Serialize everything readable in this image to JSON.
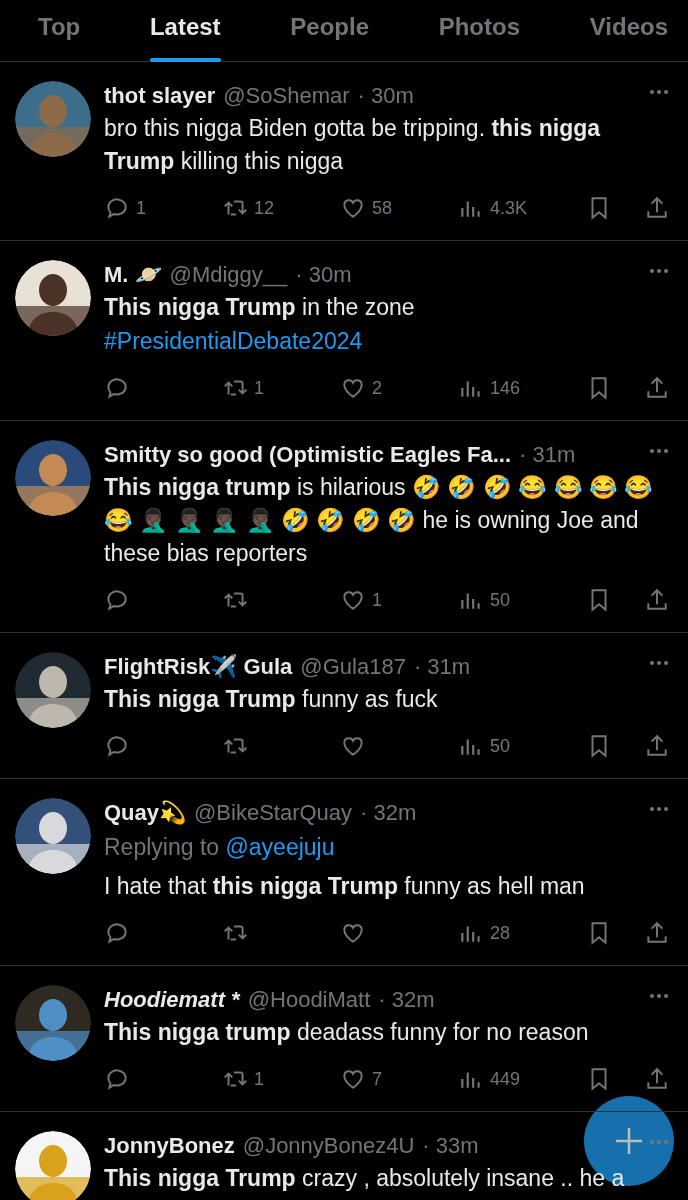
{
  "tabs": [
    {
      "label": "Top",
      "selected": false
    },
    {
      "label": "Latest",
      "selected": true
    },
    {
      "label": "People",
      "selected": false
    },
    {
      "label": "Photos",
      "selected": false
    },
    {
      "label": "Videos",
      "selected": false
    }
  ],
  "tweets": [
    {
      "name": "thot slayer",
      "italic": false,
      "handle": "@SoShemar",
      "time": "· 30m",
      "text": "bro this nigga Biden gotta be tripping. **this nigga Trump** killing this nigga",
      "stats": {
        "replies": "1",
        "retweets": "12",
        "likes": "58",
        "views": "4.3K"
      }
    },
    {
      "name": "M. 🪐",
      "italic": false,
      "handle": "@Mdiggy__",
      "time": "· 30m",
      "text": "**This nigga Trump** in the zone",
      "hashtag": "#PresidentialDebate2024",
      "stats": {
        "retweets": "1",
        "likes": "2",
        "views": "146"
      }
    },
    {
      "name": "Smitty so good (Optimistic Eagles Fa...",
      "italic": false,
      "time": "· 31m",
      "text": "**This nigga trump** is hilarious 🤣 🤣 🤣 😂 😂 😂 😂 😂 🤦🏿‍♂️ 🤦🏿‍♂️ 🤦🏿‍♂️ 🤦🏿‍♂️ 🤣 🤣 🤣 🤣 he is owning Joe and these bias reporters",
      "stats": {
        "likes": "1",
        "views": "50"
      }
    },
    {
      "name": "FlightRisk✈️ Gula",
      "italic": false,
      "handle": "@Gula187",
      "time": "· 31m",
      "text": "**This nigga Trump** funny as fuck",
      "stats": {
        "views": "50"
      }
    },
    {
      "name": "Quay💫",
      "italic": false,
      "handle": "@BikeStarQuay",
      "time": "· 32m",
      "replying_label": "Replying to",
      "replying_to": "@ayeejuju",
      "text": "I hate that **this nigga Trump** funny as hell man",
      "stats": {
        "views": "28"
      }
    },
    {
      "name": "Hoodiematt *",
      "italic": true,
      "handle": "@HoodiMatt",
      "time": "· 32m",
      "text": "**This nigga trump** deadass funny for no reason",
      "stats": {
        "retweets": "1",
        "likes": "7",
        "views": "449"
      }
    },
    {
      "name": "JonnyBonez",
      "italic": false,
      "handle": "@JonnyBonez4U",
      "time": "· 33m",
      "text": "**This nigga Trump** crazy , absolutely insane .. he a"
    }
  ],
  "compose_button": {
    "kind": "fab"
  }
}
